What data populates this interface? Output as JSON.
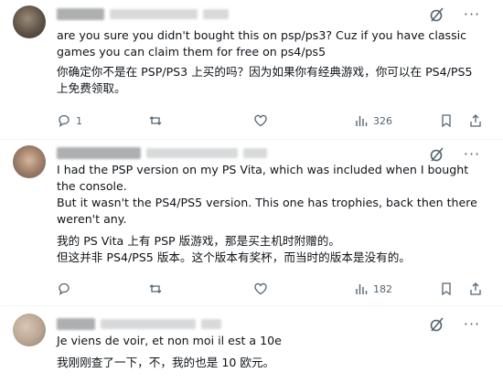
{
  "posts": [
    {
      "text_en": "are you sure you didn't bought this on psp/ps3? Cuz if you have classic games you can claim them for free on ps4/ps5",
      "text_zh": "你确定你不是在 PSP/PS3 上买的吗？因为如果你有经典游戏，你可以在 PS4/PS5 上免费领取。",
      "replies": "1",
      "views": "326"
    },
    {
      "text_en_1": "I had the PSP version on my PS Vita, which was included when I bought the console.",
      "text_en_2": "But it wasn't the PS4/PS5 version. This one has trophies, back then there weren't any.",
      "text_zh_1": "我的 PS Vita 上有 PSP 版游戏，那是买主机时附赠的。",
      "text_zh_2": "但这并非 PS4/PS5 版本。这个版本有奖杯，而当时的版本是没有的。",
      "views": "182"
    },
    {
      "text_fr": "Je viens de voir, et non moi il est a 10e",
      "text_zh": "我刚刚查了一下，不，我的也是 10 欧元。"
    }
  ],
  "icons": {
    "grok": "grok-icon",
    "more": "more-icon",
    "reply": "reply-icon",
    "repost": "repost-icon",
    "like": "like-icon",
    "views": "views-icon",
    "bookmark": "bookmark-icon",
    "share": "share-icon"
  },
  "colors": {
    "text": "#0f1419",
    "secondary": "#536471",
    "divider": "#eff3f4"
  }
}
